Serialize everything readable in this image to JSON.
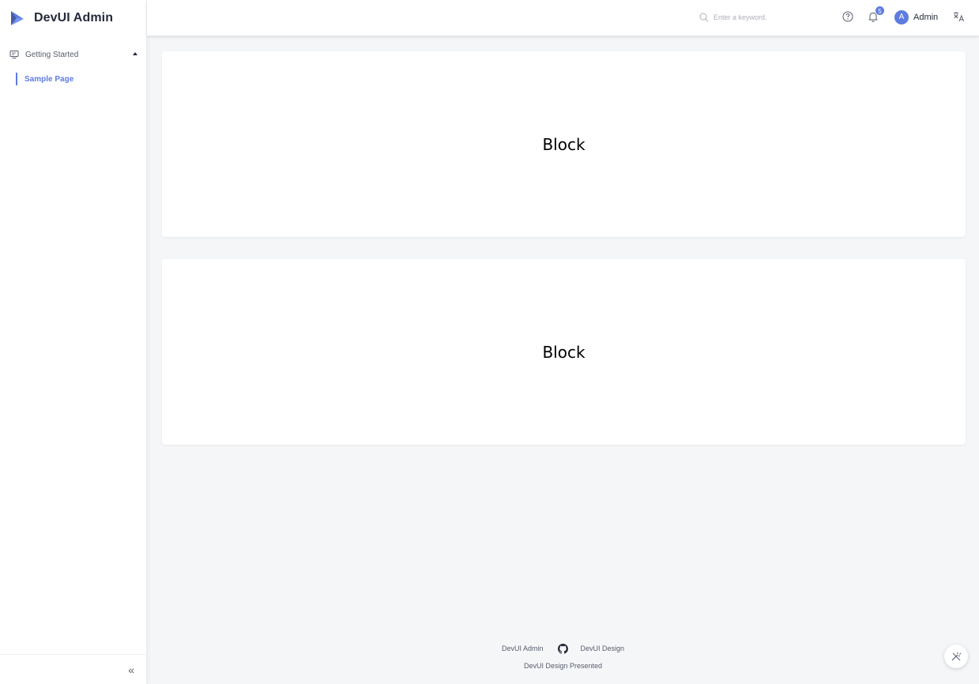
{
  "brand": {
    "title": "DevUI Admin",
    "icon": "devui-logo-icon"
  },
  "sidebar": {
    "groups": [
      {
        "label": "Getting Started",
        "icon": "monitor-icon",
        "expanded": true,
        "items": [
          {
            "label": "Sample Page",
            "active": true
          }
        ]
      }
    ],
    "collapse_label": "«"
  },
  "header": {
    "search_placeholder": "Enter a keyword.",
    "notification_count": "5",
    "user": {
      "avatar_letter": "A",
      "name": "Admin"
    },
    "icons": [
      "search-icon",
      "help-icon",
      "bell-icon",
      "translate-icon"
    ]
  },
  "main": {
    "blocks": [
      {
        "label": "Block"
      },
      {
        "label": "Block"
      }
    ]
  },
  "footer": {
    "link_admin": "DevUI Admin",
    "link_design": "DevUI Design",
    "credit": "DevUI Design Presented"
  },
  "colors": {
    "accent": "#5e7ce0",
    "background": "#f5f6f8",
    "text": "#252b3a"
  }
}
